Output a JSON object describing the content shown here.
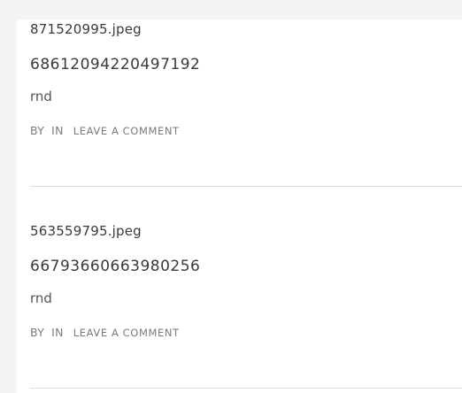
{
  "posts": [
    {
      "filename": "871520995.jpeg",
      "title": "68612094220497192",
      "excerpt": "rnd",
      "meta": {
        "by": "BY",
        "in": "IN",
        "comment": "LEAVE A COMMENT"
      }
    },
    {
      "filename": "563559795.jpeg",
      "title": "66793660663980256",
      "excerpt": "rnd",
      "meta": {
        "by": "BY",
        "in": "IN",
        "comment": "LEAVE A COMMENT"
      }
    }
  ]
}
